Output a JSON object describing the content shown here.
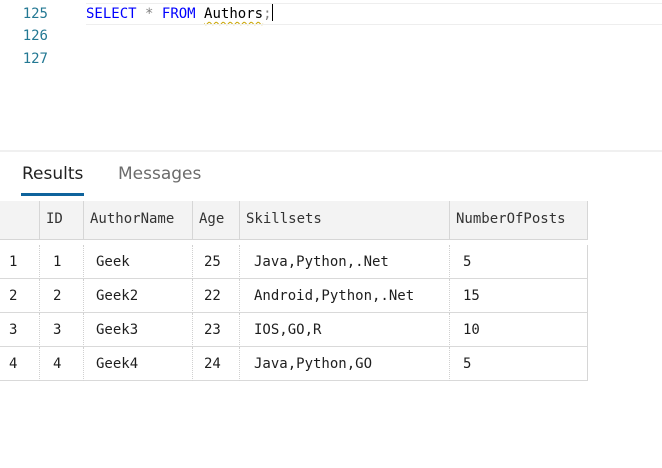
{
  "editor": {
    "lines": [
      {
        "number": "125",
        "keyword1": "SELECT",
        "star": "*",
        "keyword2": "FROM",
        "table": "Authors",
        "semicolon": ";"
      },
      {
        "number": "126"
      },
      {
        "number": "127"
      }
    ]
  },
  "results_pane": {
    "tabs": [
      {
        "label": "Results",
        "active": true
      },
      {
        "label": "Messages",
        "active": false
      }
    ],
    "columns": [
      "",
      "ID",
      "AuthorName",
      "Age",
      "Skillsets",
      "NumberOfPosts"
    ],
    "rows": [
      {
        "row_num": "1",
        "id": "1",
        "author": "Geek",
        "age": "25",
        "skills": "Java,Python,.Net",
        "posts": "5"
      },
      {
        "row_num": "2",
        "id": "2",
        "author": "Geek2",
        "age": "22",
        "skills": "Android,Python,.Net",
        "posts": "15"
      },
      {
        "row_num": "3",
        "id": "3",
        "author": "Geek3",
        "age": "23",
        "skills": "IOS,GO,R",
        "posts": "10"
      },
      {
        "row_num": "4",
        "id": "4",
        "author": "Geek4",
        "age": "24",
        "skills": "Java,Python,GO",
        "posts": "5"
      }
    ]
  },
  "colors": {
    "line_number": "#237893",
    "keyword": "#0000ff",
    "active_tab_underline": "#0e639c",
    "header_bg": "#f3f3f3"
  }
}
